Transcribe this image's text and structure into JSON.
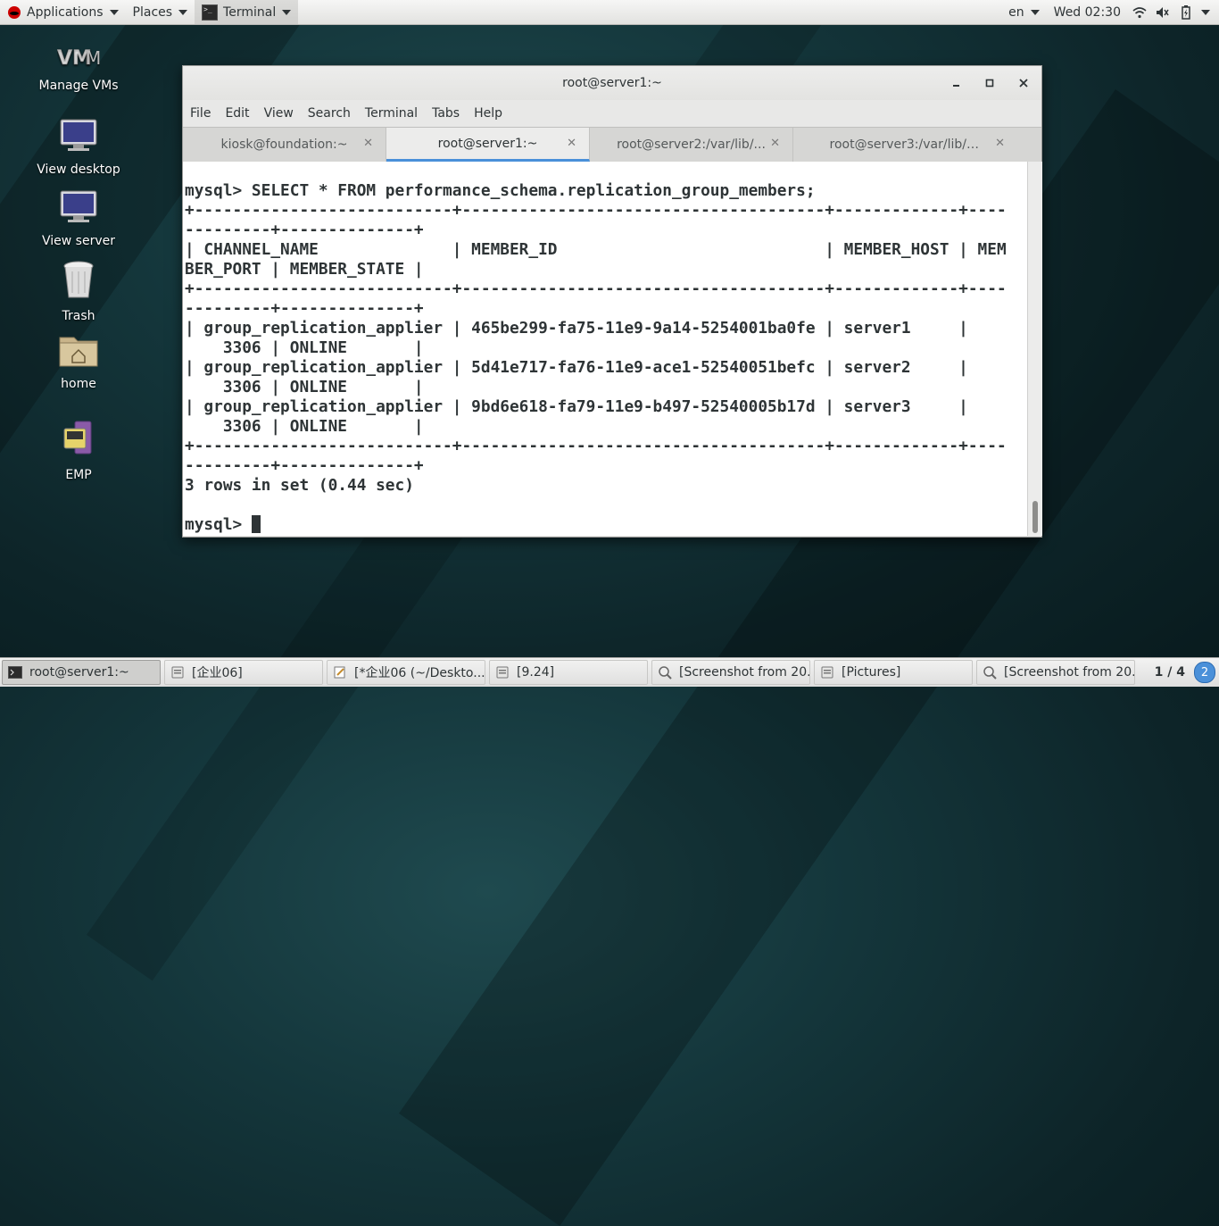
{
  "topbar": {
    "applications": "Applications",
    "places": "Places",
    "terminal": "Terminal",
    "language": "en",
    "clock": "Wed 02:30"
  },
  "desktop": {
    "icons": [
      {
        "label": "Manage VMs",
        "icon": "vm-icon"
      },
      {
        "label": "View desktop",
        "icon": "monitor-icon"
      },
      {
        "label": "View server",
        "icon": "monitor-icon"
      },
      {
        "label": "Trash",
        "icon": "trash-icon"
      },
      {
        "label": "home",
        "icon": "home-folder-icon"
      },
      {
        "label": "EMP",
        "icon": "emp-app-icon"
      }
    ]
  },
  "window": {
    "title": "root@server1:~",
    "menu": [
      "File",
      "Edit",
      "View",
      "Search",
      "Terminal",
      "Tabs",
      "Help"
    ],
    "tabs": [
      {
        "label": "kiosk@foundation:~",
        "active": false
      },
      {
        "label": "root@server1:~",
        "active": true
      },
      {
        "label": "root@server2:/var/lib/...",
        "active": false
      },
      {
        "label": "root@server3:/var/lib/m...",
        "active": false
      }
    ],
    "terminal_lines": [
      "mysql> SELECT * FROM performance_schema.replication_group_members;",
      "+---------------------------+--------------------------------------+-------------+----",
      "---------+--------------+",
      "| CHANNEL_NAME              | MEMBER_ID                            | MEMBER_HOST | MEM",
      "BER_PORT | MEMBER_STATE |",
      "+---------------------------+--------------------------------------+-------------+----",
      "---------+--------------+",
      "| group_replication_applier | 465be299-fa75-11e9-9a14-5254001ba0fe | server1     |",
      "    3306 | ONLINE       |",
      "| group_replication_applier | 5d41e717-fa76-11e9-ace1-52540051befc | server2     |",
      "    3306 | ONLINE       |",
      "| group_replication_applier | 9bd6e618-fa79-11e9-b497-52540005b17d | server3     |",
      "    3306 | ONLINE       |",
      "+---------------------------+--------------------------------------+-------------+----",
      "---------+--------------+",
      "3 rows in set (0.44 sec)",
      "",
      "mysql> "
    ]
  },
  "taskbar": {
    "tasks": [
      {
        "label": "root@server1:~",
        "icon": "terminal-icon",
        "active": true
      },
      {
        "label": "[企业06]",
        "icon": "file-manager-icon",
        "active": false
      },
      {
        "label": "[*企业06 (~/Deskto...",
        "icon": "text-editor-icon",
        "active": false
      },
      {
        "label": "[9.24]",
        "icon": "file-manager-icon",
        "active": false
      },
      {
        "label": "[Screenshot from 20...",
        "icon": "image-viewer-icon",
        "active": false
      },
      {
        "label": "[Pictures]",
        "icon": "file-manager-icon",
        "active": false
      },
      {
        "label": "[Screenshot from 20...",
        "icon": "image-viewer-icon",
        "active": false
      }
    ],
    "workspace": "1 / 4",
    "notifications": "2"
  },
  "colors": {
    "accent": "#4a90d9",
    "terminal_text": "#2e3436",
    "terminal_bg": "#ffffff"
  }
}
